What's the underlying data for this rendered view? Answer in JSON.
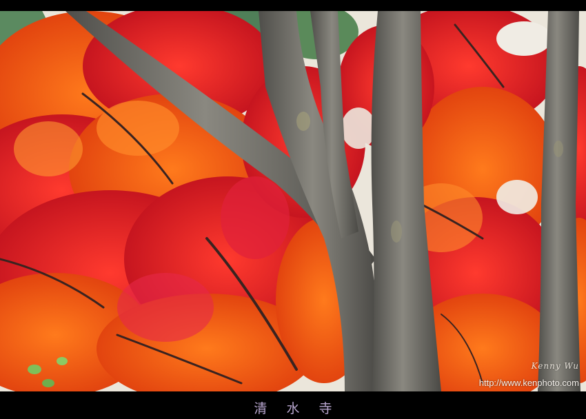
{
  "photo": {
    "subject": "maple-foliage-with-tree-trunks",
    "palette": {
      "red": "#d4202a",
      "orange": "#ef5b16",
      "deep_red": "#b3141e",
      "sky": "#ece7dc",
      "trunk": "#6c6a64",
      "pine": "#5f8d63"
    }
  },
  "watermark": {
    "signature": "Kenny Wu",
    "url": "http://www.kenphoto.com"
  },
  "caption": {
    "chars": [
      "清",
      "水",
      "寺"
    ]
  }
}
